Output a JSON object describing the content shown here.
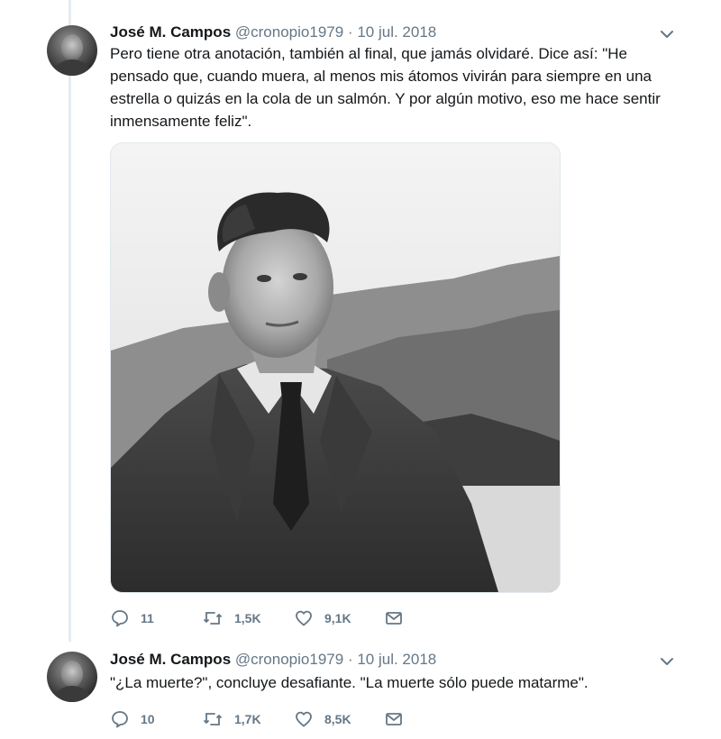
{
  "tweets": [
    {
      "author_name": "José M. Campos",
      "handle": "@cronopio1979",
      "separator": "·",
      "date": "10 jul. 2018",
      "text": "Pero tiene otra anotación, también al final, que jamás olvidaré. Dice así: \"He pensado que, cuando muera, al menos mis átomos vivirán para siempre en una estrella o quizás en la cola de un salmón. Y por algún motivo, eso me hace sentir inmensamente feliz\".",
      "has_photo": true,
      "replies": "11",
      "retweets": "1,5K",
      "likes": "9,1K"
    },
    {
      "author_name": "José M. Campos",
      "handle": "@cronopio1979",
      "separator": "·",
      "date": "10 jul. 2018",
      "text": "\"¿La muerte?\", concluye desafiante. \"La muerte sólo puede matarme\".",
      "has_photo": false,
      "replies": "10",
      "retweets": "1,7K",
      "likes": "8,5K"
    }
  ],
  "icons": {
    "reply": "reply-icon",
    "retweet": "retweet-icon",
    "like": "heart-icon",
    "message": "envelope-icon",
    "menu": "chevron-down-icon"
  },
  "colors": {
    "text": "#14171a",
    "secondary": "#657786",
    "thread_line": "#e6ecf0"
  }
}
